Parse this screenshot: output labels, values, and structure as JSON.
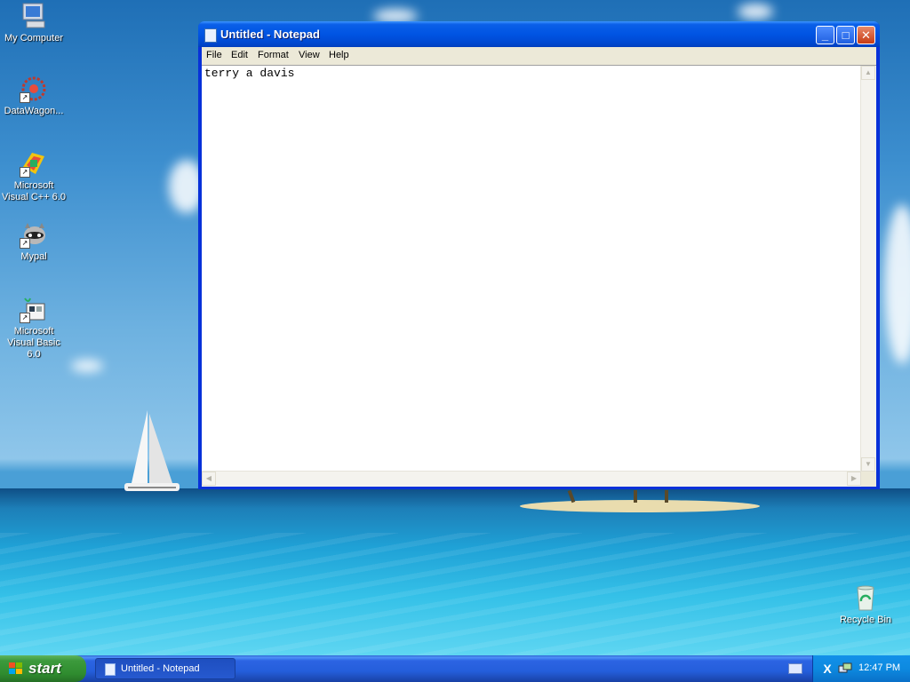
{
  "desktop": {
    "icons": [
      {
        "label": "My Computer",
        "icon": "computer-icon"
      },
      {
        "label": "DataWagon...",
        "icon": "datawagon-icon"
      },
      {
        "label": "Microsoft Visual C++ 6.0",
        "icon": "visual-cpp-icon"
      },
      {
        "label": "Mypal",
        "icon": "mypal-icon"
      },
      {
        "label": "Microsoft Visual Basic 6.0",
        "icon": "visual-basic-icon"
      },
      {
        "label": "Recycle Bin",
        "icon": "recycle-bin-icon"
      }
    ]
  },
  "window": {
    "title": "Untitled - Notepad",
    "icon": "notepad-icon",
    "menu": [
      "File",
      "Edit",
      "Format",
      "View",
      "Help"
    ],
    "content": "terry a davis",
    "controls": {
      "minimize": "minimize-icon",
      "maximize": "maximize-icon",
      "close": "close-icon"
    }
  },
  "taskbar": {
    "start_label": "start",
    "tasks": [
      {
        "label": "Untitled - Notepad",
        "icon": "notepad-icon"
      }
    ],
    "clock": "12:47 PM"
  },
  "colors": {
    "titlebar": "#0054e3",
    "taskbar": "#245edb",
    "start": "#3c9a3c",
    "close": "#c73b14",
    "menubar": "#ece9d8"
  }
}
